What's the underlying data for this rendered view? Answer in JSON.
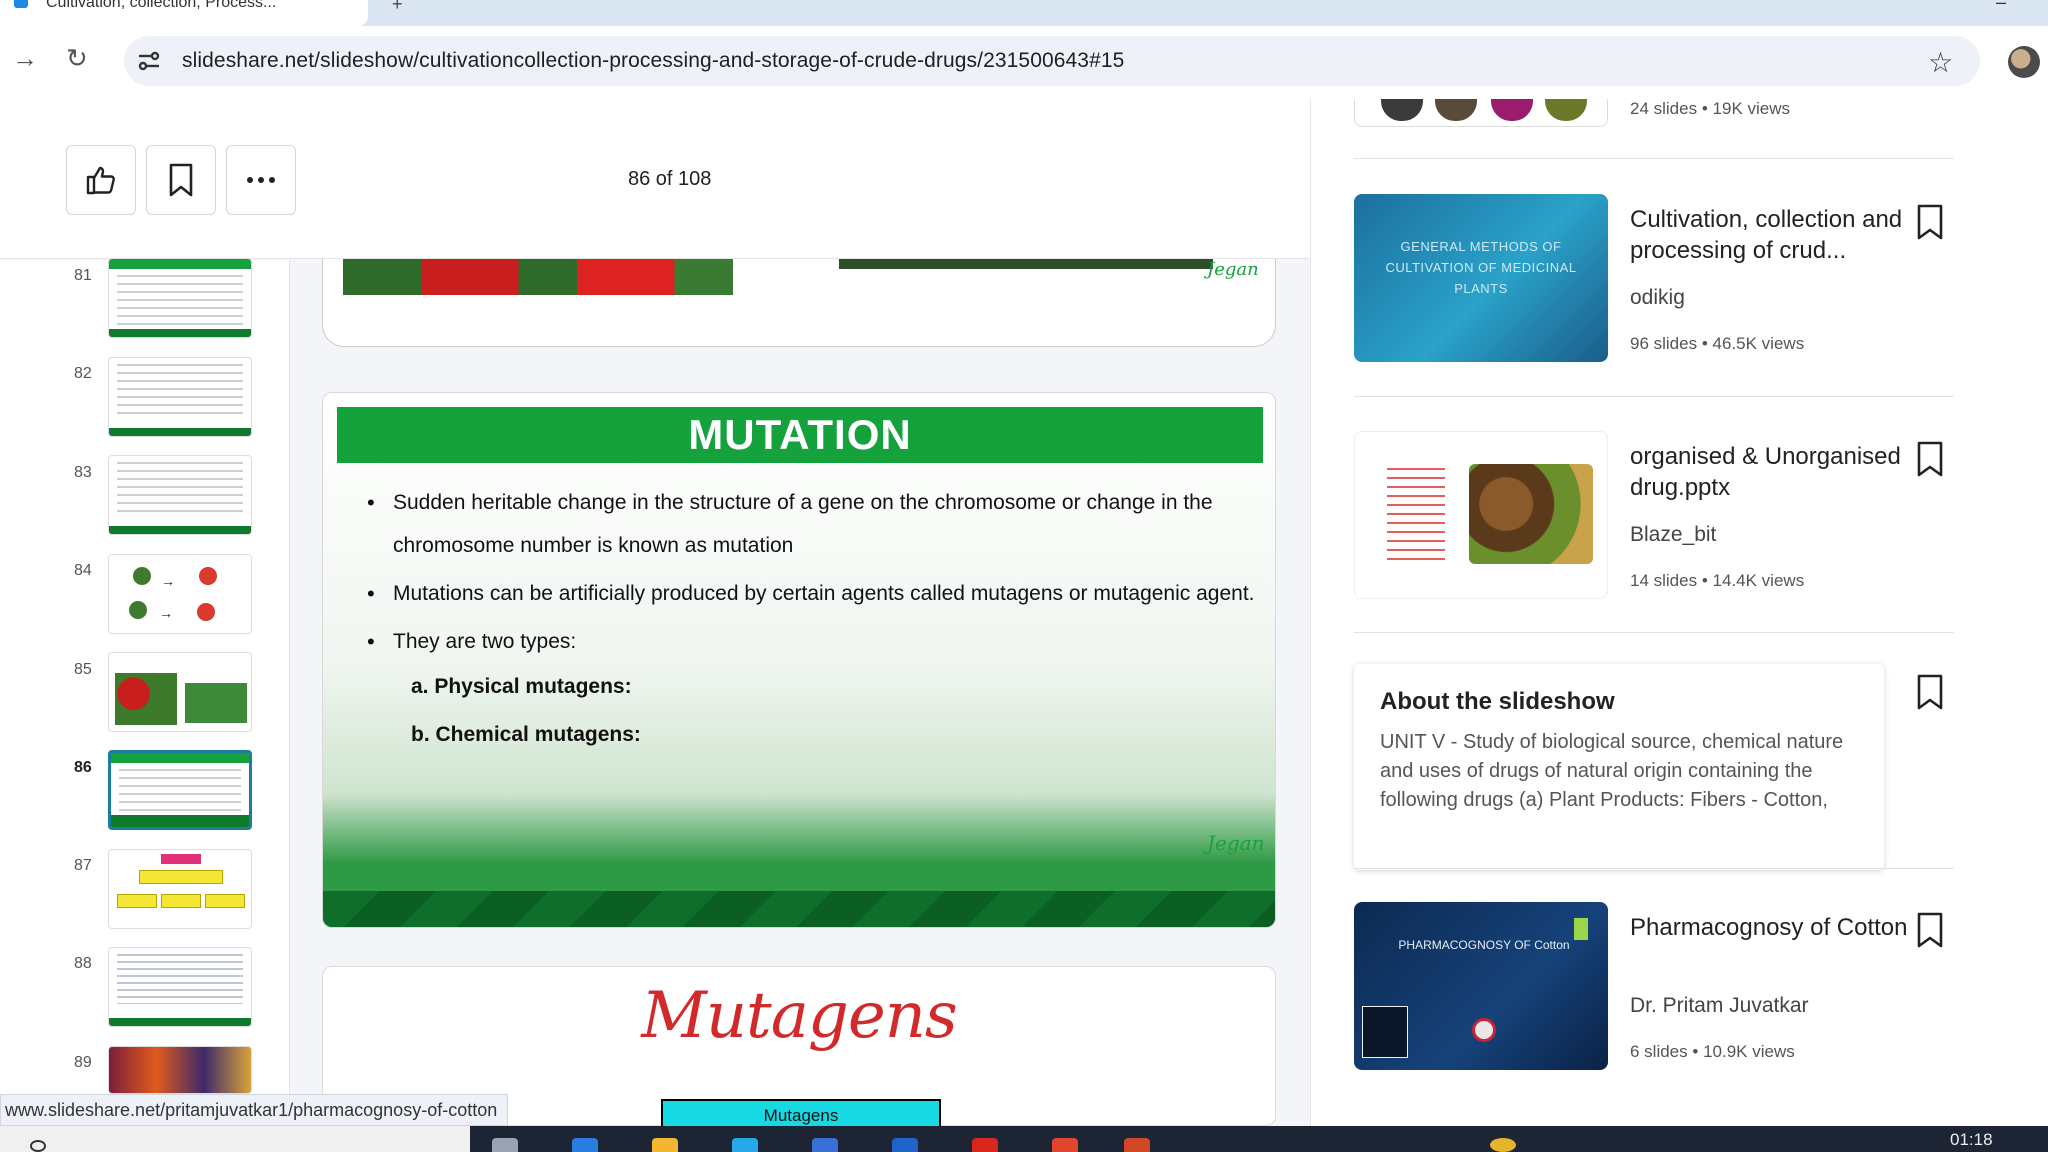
{
  "browser": {
    "tab_title": "Cultivation, collection, Process...",
    "url_host": "slideshare.net",
    "url_path": "/slideshow/cultivationcollection-processing-and-storage-of-crude-drugs/231500643#15",
    "status_url": "www.slideshare.net/pritamjuvatkar1/pharmacognosy-of-cotton"
  },
  "viewer": {
    "page_counter": "86 of 108",
    "like_icon": "thumbs-up-icon",
    "save_icon": "bookmark-icon",
    "more_icon": "more-horizontal-icon"
  },
  "thumbnails": [
    {
      "num": "81"
    },
    {
      "num": "82"
    },
    {
      "num": "83"
    },
    {
      "num": "84"
    },
    {
      "num": "85"
    },
    {
      "num": "86"
    },
    {
      "num": "87"
    },
    {
      "num": "88"
    },
    {
      "num": "89"
    }
  ],
  "slides": {
    "prev_signature": "Jegan",
    "main": {
      "title": "MUTATION",
      "bullets": [
        "Sudden heritable change in the structure of a gene on the chromosome or change in the chromosome number is known as mutation",
        "Mutations can be artificially produced by certain agents called mutagens or mutagenic agent.",
        "They are two types:"
      ],
      "subitems": [
        "a. Physical mutagens:",
        "b. Chemical mutagens:"
      ],
      "signature": "Jegan"
    },
    "next": {
      "title": "Mutagens",
      "chip": "Mutagens"
    }
  },
  "sidebar": {
    "top_meta": {
      "slides": "24 slides",
      "views": "19K views"
    },
    "related": [
      {
        "title": "Cultivation, collection and processing of crud...",
        "author": "odikig",
        "slides": "96 slides",
        "views": "46.5K views",
        "thumb_text": "GENERAL METHODS OF CULTIVATION OF MEDICINAL PLANTS"
      },
      {
        "title": "organised & Unorganised drug.pptx",
        "author": "Blaze_bit",
        "slides": "14 slides",
        "views": "14.4K views"
      },
      {
        "title": "Pharmacognosy of Cotton",
        "author": "Dr. Pritam Juvatkar",
        "slides": "6 slides",
        "views": "10.9K views",
        "thumb_text": "PHARMACOGNOSY OF Cotton"
      }
    ],
    "about": {
      "title": "About the slideshow",
      "text": "UNIT V - Study of biological source, chemical nature and uses of drugs of natural origin containing the following drugs (a) Plant Products: Fibers - Cotton,"
    },
    "separator": "•"
  },
  "taskbar": {
    "clock": "01:18"
  }
}
